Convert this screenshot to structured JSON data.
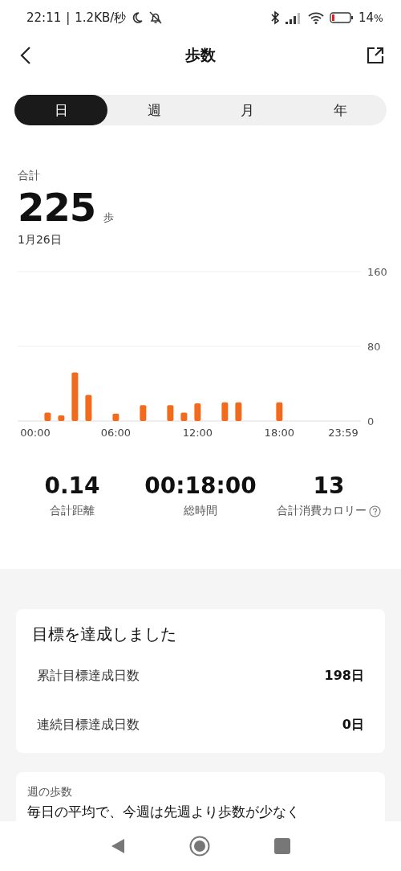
{
  "status_bar": {
    "time": "22:11",
    "separator": "|",
    "speed": "1.2KB/秒",
    "battery": "14",
    "battery_unit": "%"
  },
  "header": {
    "title": "歩数"
  },
  "tabs": [
    {
      "label": "日",
      "selected": true
    },
    {
      "label": "週",
      "selected": false
    },
    {
      "label": "月",
      "selected": false
    },
    {
      "label": "年",
      "selected": false
    }
  ],
  "summary": {
    "label": "合計",
    "value": "225",
    "unit": "歩",
    "date": "1月26日"
  },
  "chart": {
    "chart_data": {
      "type": "bar",
      "x": [
        1,
        2,
        3,
        4,
        6,
        8,
        10,
        11,
        12,
        14,
        15,
        18
      ],
      "series": [
        {
          "color": "#f26b1d",
          "values": [
            9,
            6,
            52,
            28,
            8,
            17,
            17,
            9,
            19,
            20,
            20,
            20
          ]
        }
      ],
      "xlim": [
        -1.2,
        23.98
      ],
      "ylim": [
        0,
        160
      ],
      "yticks": [
        0,
        80,
        160
      ],
      "xticks": [
        {
          "value": 0,
          "label": "00:00"
        },
        {
          "value": 6,
          "label": "06:00"
        },
        {
          "value": 12,
          "label": "12:00"
        },
        {
          "value": 18,
          "label": "18:00"
        },
        {
          "value": 23.98,
          "label": "23:59"
        }
      ]
    }
  },
  "stats": [
    {
      "value": "0.14",
      "label": "合計距離",
      "help": false
    },
    {
      "value": "00:18:00",
      "label": "総時間",
      "help": false
    },
    {
      "value": "13",
      "label": "合計消費カロリー",
      "help": true
    }
  ],
  "goal_card": {
    "title": "目標を達成しました",
    "rows": [
      {
        "label": "累計目標達成日数",
        "value": "198日"
      },
      {
        "label": "連続目標達成日数",
        "value": "0日"
      }
    ]
  },
  "week_card": {
    "title": "週の歩数",
    "text": "毎日の平均で、今週は先週より歩数が少なく"
  }
}
